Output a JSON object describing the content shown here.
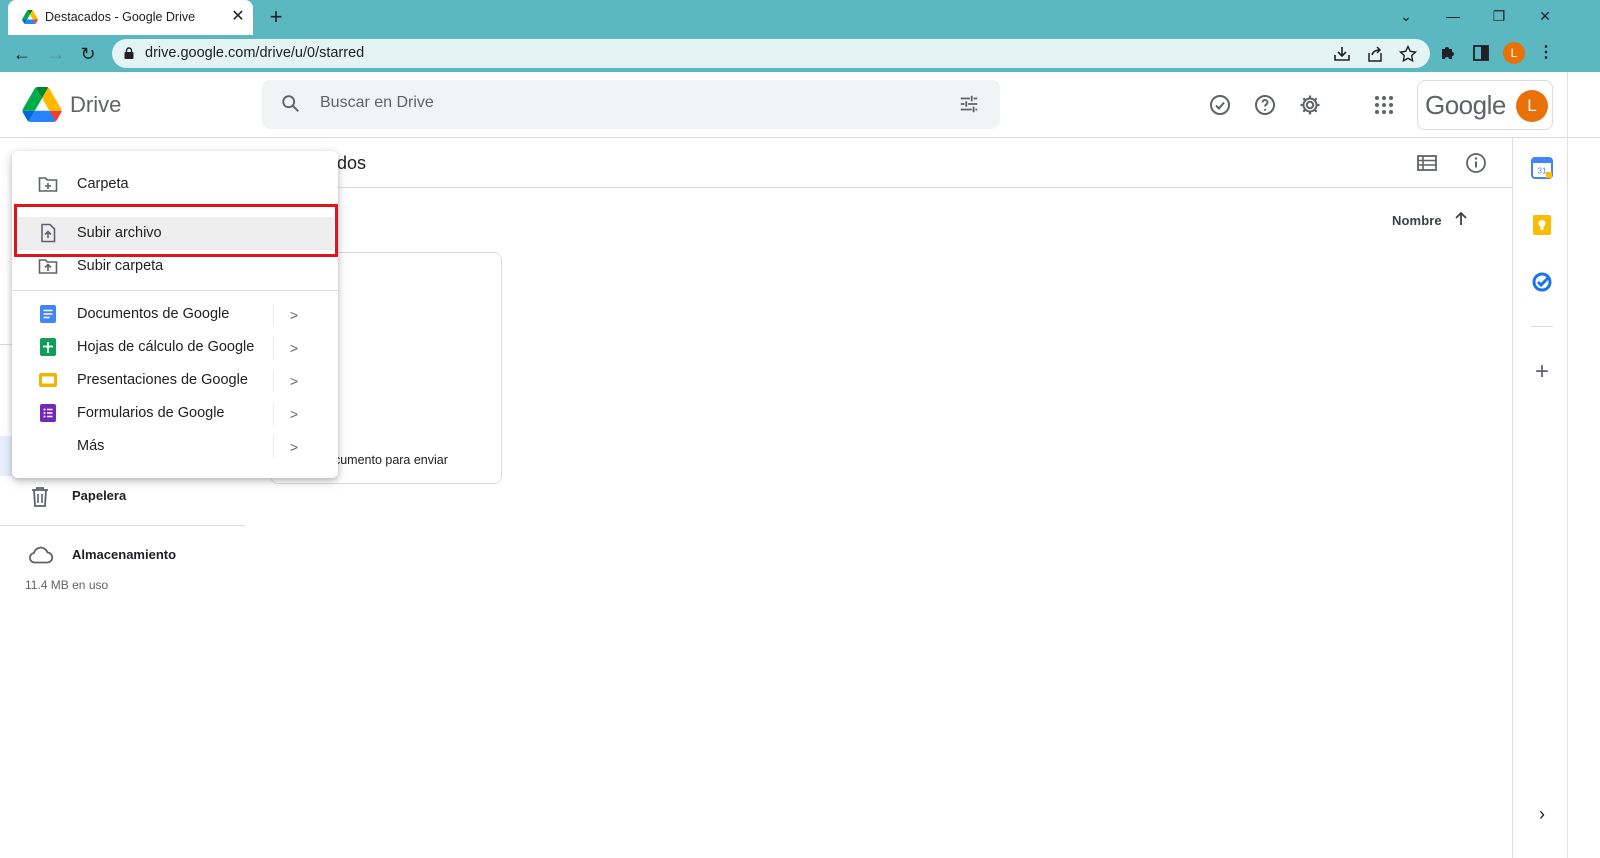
{
  "browser": {
    "tab_title": "Destacados - Google Drive",
    "url": "drive.google.com/drive/u/0/starred",
    "profile_initial": "L"
  },
  "header": {
    "app_name": "Drive",
    "search_placeholder": "Buscar en Drive",
    "brand_word": "Google",
    "avatar_initial": "L"
  },
  "main": {
    "page_title_visible": "dos",
    "sort_label": "Nombre",
    "file_name_visible": "ocumento para enviar"
  },
  "sidebar": {
    "trash_label": "Papelera",
    "storage_label": "Almacenamiento",
    "storage_usage": "11.4 MB en uso"
  },
  "new_menu": {
    "items": [
      {
        "label": "Carpeta",
        "icon": "new-folder-icon"
      },
      {
        "label": "Subir archivo",
        "icon": "upload-file-icon",
        "highlighted": true
      },
      {
        "label": "Subir carpeta",
        "icon": "upload-folder-icon"
      },
      {
        "label": "Documentos de Google",
        "icon": "google-docs-icon",
        "submenu": true
      },
      {
        "label": "Hojas de cálculo de Google",
        "icon": "google-sheets-icon",
        "submenu": true
      },
      {
        "label": "Presentaciones de Google",
        "icon": "google-slides-icon",
        "submenu": true
      },
      {
        "label": "Formularios de Google",
        "icon": "google-forms-icon",
        "submenu": true
      },
      {
        "label": "Más",
        "icon": "",
        "submenu": true
      }
    ]
  },
  "side_panel": {
    "calendar_day": "31"
  },
  "colors": {
    "chrome_frame": "#5cb8c0",
    "highlight_border": "#e1141b",
    "avatar": "#e8710a",
    "docs_blue": "#4285f4",
    "sheets_green": "#0f9d58",
    "slides_yellow": "#f4b400",
    "forms_purple": "#7627bb"
  }
}
